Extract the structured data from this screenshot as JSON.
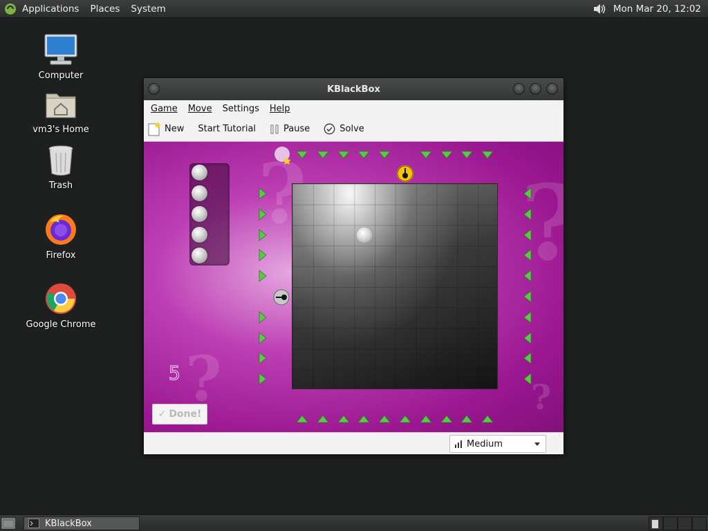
{
  "top_panel": {
    "menus": [
      "Applications",
      "Places",
      "System"
    ],
    "clock": "Mon Mar 20, 12:02"
  },
  "desktop": {
    "icons": [
      {
        "label": "Computer",
        "icon": "computer-icon"
      },
      {
        "label": "vm3's Home",
        "icon": "home-folder-icon"
      },
      {
        "label": "Trash",
        "icon": "trash-icon"
      },
      {
        "label": "Firefox",
        "icon": "firefox-icon"
      },
      {
        "label": "Google Chrome",
        "icon": "chrome-icon"
      }
    ]
  },
  "window": {
    "title": "KBlackBox",
    "menu": [
      "Game",
      "Move",
      "Settings",
      "Help"
    ],
    "toolbar": {
      "new_label": "New",
      "tutorial_label": "Start Tutorial",
      "pause_label": "Pause",
      "solve_label": "Solve"
    },
    "game": {
      "score": "5",
      "balls_remaining": 5,
      "done_label": "Done!",
      "grid_size": 10
    },
    "status": {
      "difficulty": "Medium"
    }
  },
  "taskbar": {
    "task_label": "KBlackBox"
  },
  "colors": {
    "board": "#a61a9c",
    "laser_green": "#5cc84a",
    "marker_yellow": "#f5c20a"
  }
}
